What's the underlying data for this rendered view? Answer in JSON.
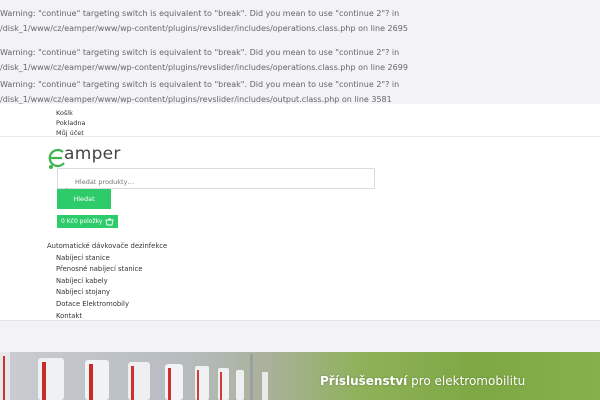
{
  "warnings": [
    "Warning: \"continue\" targeting switch is equivalent to \"break\". Did you mean to use \"continue 2\"? in /disk_1/www/cz/eamper/www/wp-content/plugins/revslider/includes/operations.class.php on line 2695",
    "Warning: \"continue\" targeting switch is equivalent to \"break\". Did you mean to use \"continue 2\"? in /disk_1/www/cz/eamper/www/wp-content/plugins/revslider/includes/operations.class.php on line 2699",
    "Warning: \"continue\" targeting switch is equivalent to \"break\". Did you mean to use \"continue 2\"? in /disk_1/www/cz/eamper/www/wp-content/plugins/revslider/includes/output.class.php on line 3581"
  ],
  "top_menu": [
    "Košík",
    "Pokladna",
    "Můj účet"
  ],
  "logo": {
    "text": "amper"
  },
  "search": {
    "placeholder": "Hledat produkty…",
    "button": "Hledat"
  },
  "cart": {
    "label": "0 Kč0 položky",
    "icon": "basket-icon"
  },
  "main_menu": {
    "top": "Automatické dávkovače dezinfekce",
    "items": [
      "Nabíjecí stanice",
      "Přenosné nabíjecí stanice",
      "Nabíjecí kabely",
      "Nabíjecí stojany",
      "Dotace Elektromobily",
      "Kontakt"
    ]
  },
  "banner": {
    "bold": "Příslušenství",
    "rest": " pro elektromobilitu"
  },
  "colors": {
    "accent": "#2ecb6b",
    "logo_green": "#3cb54a"
  }
}
